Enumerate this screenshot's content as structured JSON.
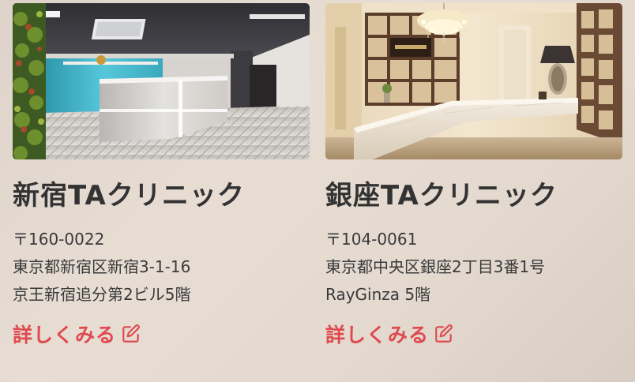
{
  "colors": {
    "accent": "#e04a4e",
    "text": "#333333"
  },
  "clinics": [
    {
      "name": "新宿TAクリニック",
      "address_lines": [
        "〒160-0022",
        "東京都新宿区新宿3-1-16",
        "京王新宿追分第2ビル5階"
      ],
      "more_label": "詳しくみる",
      "photo_alt": "reception-desk-photo"
    },
    {
      "name": "銀座TAクリニック",
      "address_lines": [
        "〒104-0061",
        "東京都中央区銀座2丁目3番1号",
        "RayGinza 5階"
      ],
      "more_label": "詳しくみる",
      "photo_alt": "reception-desk-photo"
    }
  ]
}
